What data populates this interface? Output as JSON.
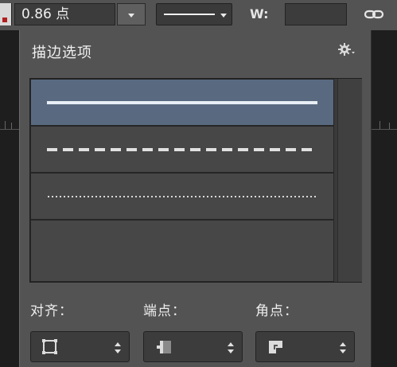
{
  "toolbar": {
    "stroke_width": "0.86 点",
    "w_label": "W:",
    "w_value": ""
  },
  "panel": {
    "title": "描边选项",
    "stroke_styles": [
      "solid",
      "dashed",
      "dotted"
    ],
    "selected_style": "solid",
    "align_label": "对齐：",
    "caps_label": "端点：",
    "corners_label": "角点："
  },
  "colors": {
    "selected_row": "#596a80",
    "panel_bg": "#535353",
    "list_bg": "#3a3a3a"
  },
  "icons": {
    "toolbar": [
      "chevron-down-icon",
      "link-icon"
    ],
    "panel": [
      "gear-icon",
      "align-inside-icon",
      "cap-butt-icon",
      "corner-miter-icon",
      "up-down-icon"
    ]
  }
}
